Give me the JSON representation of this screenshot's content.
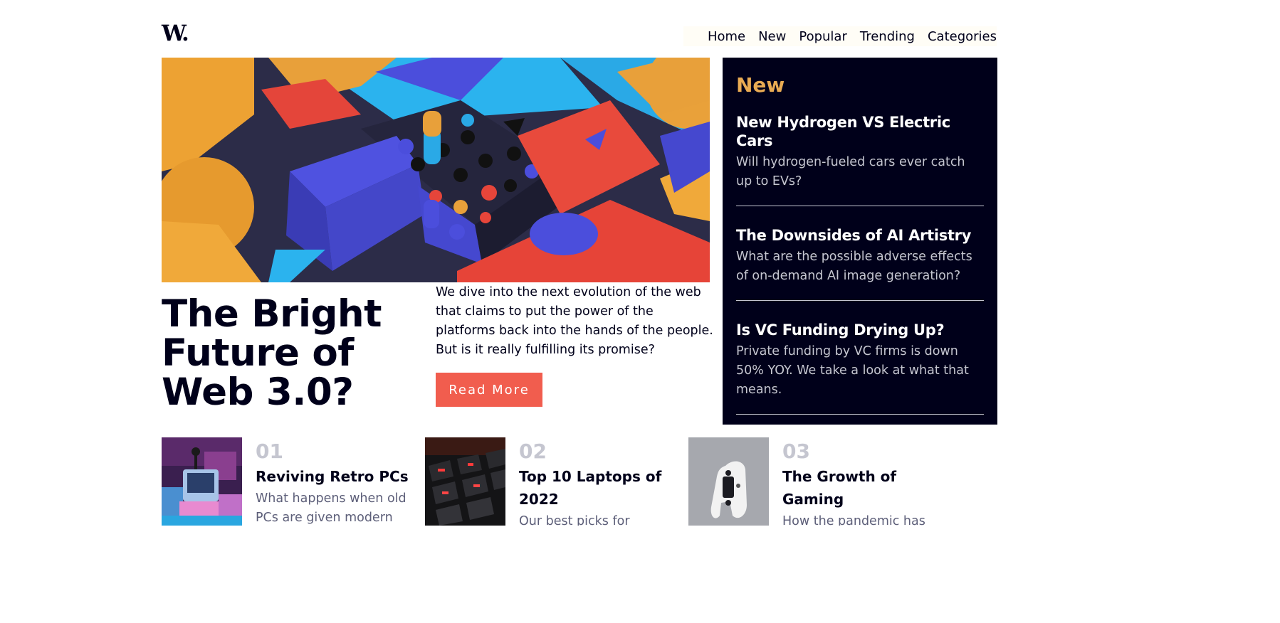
{
  "header": {
    "logo": "W.",
    "nav": [
      "Home",
      "New",
      "Popular",
      "Trending",
      "Categories"
    ]
  },
  "hero": {
    "title": "The Bright Future of Web 3.0?",
    "description": "We dive into the next evolution of the web that claims to put the power of the platforms back into the hands of the people. But is it really fulfilling its promise?",
    "button_label": "Read More"
  },
  "sidebar": {
    "heading": "New",
    "items": [
      {
        "title": "New Hydrogen VS Electric Cars",
        "description": "Will hydrogen-fueled cars ever catch up to EVs?"
      },
      {
        "title": "The Downsides of AI Artistry",
        "description": "What are the possible adverse effects of on-demand AI image generation?"
      },
      {
        "title": "Is VC Funding Drying Up?",
        "description": "Private funding by VC firms is down 50% YOY. We take a look at what that means."
      }
    ]
  },
  "cards": [
    {
      "number": "01",
      "title": "Reviving Retro PCs",
      "description": "What happens when old PCs are given modern"
    },
    {
      "number": "02",
      "title": "Top 10 Laptops of 2022",
      "description": "Our best picks for various"
    },
    {
      "number": "03",
      "title": "The Growth of Gaming",
      "description": "How the pandemic has"
    }
  ],
  "colors": {
    "navy": "#00001a",
    "accent_orange": "#e9ab53",
    "button_red": "#f15d4e",
    "muted_gray": "#c5c6d0",
    "text_gray": "#5d5f79"
  }
}
